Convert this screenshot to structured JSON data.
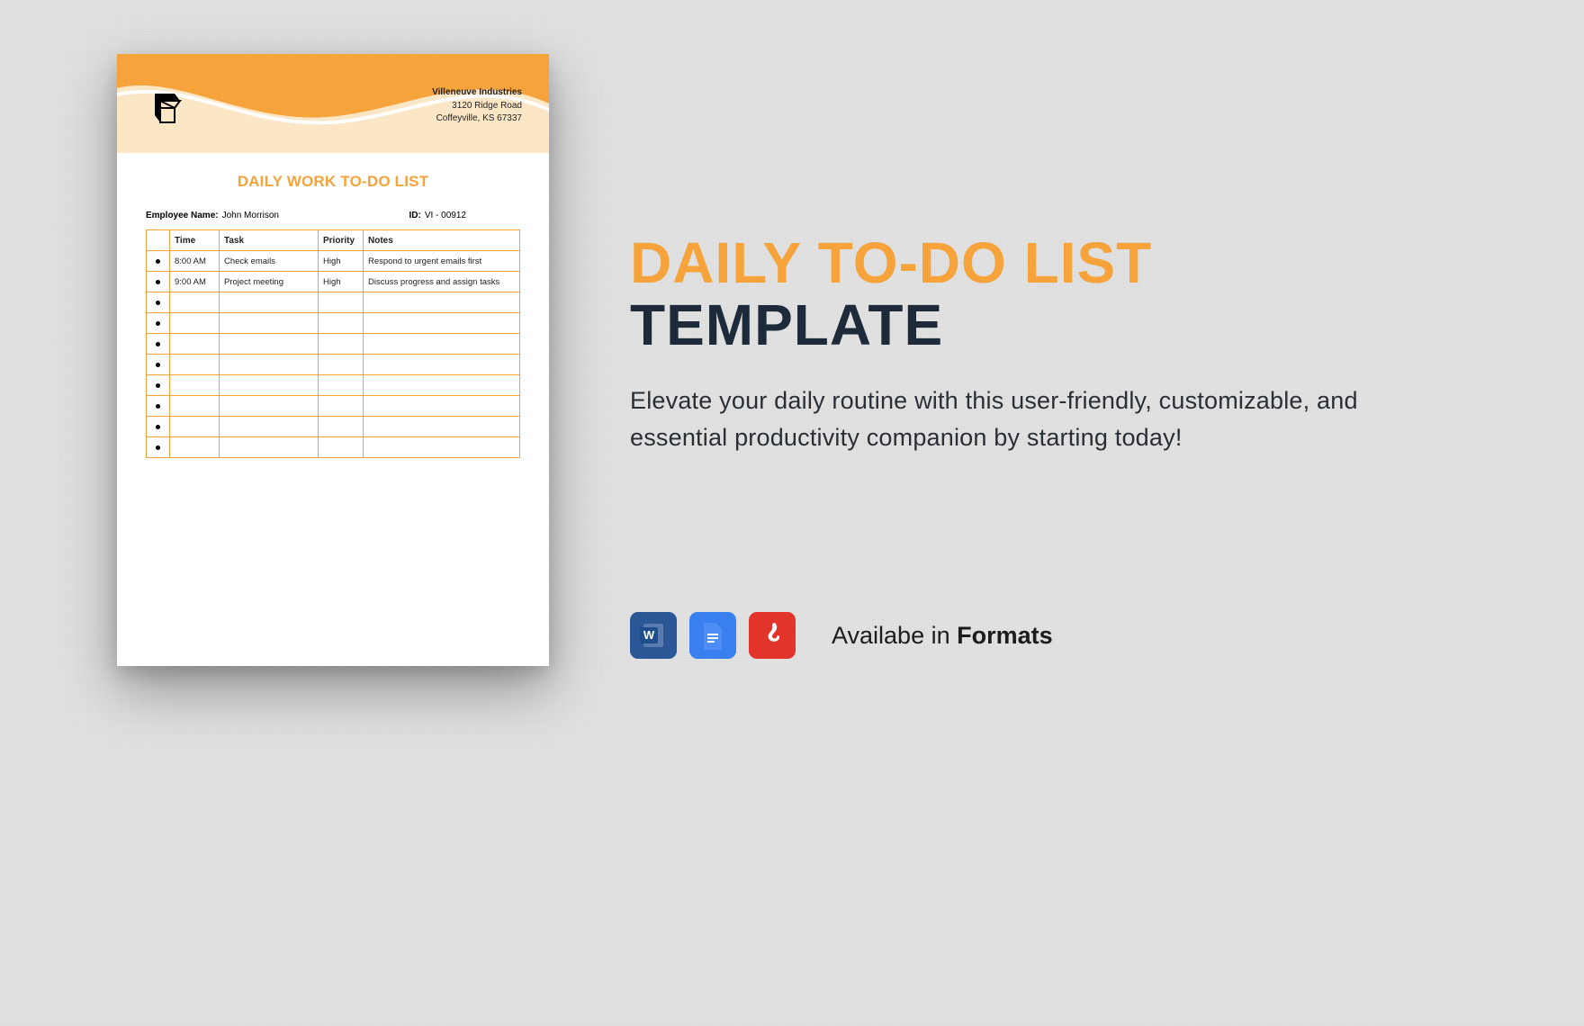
{
  "doc": {
    "company": {
      "name": "Villeneuve Industries",
      "addr1": "3120 Ridge Road",
      "addr2": "Coffeyville, KS 67337"
    },
    "title": "DAILY WORK TO-DO LIST",
    "meta": {
      "emp_label": "Employee Name:",
      "emp_value": "John Morrison",
      "id_label": "ID:",
      "id_value": "VI - 00912"
    },
    "columns": {
      "time": "Time",
      "task": "Task",
      "priority": "Priority",
      "notes": "Notes"
    },
    "rows": [
      {
        "time": "8:00 AM",
        "task": "Check emails",
        "priority": "High",
        "notes": "Respond to urgent emails first"
      },
      {
        "time": "9:00 AM",
        "task": "Project meeting",
        "priority": "High",
        "notes": "Discuss progress and assign tasks"
      },
      {
        "time": "",
        "task": "",
        "priority": "",
        "notes": ""
      },
      {
        "time": "",
        "task": "",
        "priority": "",
        "notes": ""
      },
      {
        "time": "",
        "task": "",
        "priority": "",
        "notes": ""
      },
      {
        "time": "",
        "task": "",
        "priority": "",
        "notes": ""
      },
      {
        "time": "",
        "task": "",
        "priority": "",
        "notes": ""
      },
      {
        "time": "",
        "task": "",
        "priority": "",
        "notes": ""
      },
      {
        "time": "",
        "task": "",
        "priority": "",
        "notes": ""
      },
      {
        "time": "",
        "task": "",
        "priority": "",
        "notes": ""
      }
    ]
  },
  "promo": {
    "heading_line1": "DAILY TO-DO LIST",
    "heading_line2": "TEMPLATE",
    "description": "Elevate your daily routine with this user-friendly, customizable, and essential productivity companion by starting today!",
    "formats_prefix": "Availabe in ",
    "formats_bold": "Formats"
  }
}
